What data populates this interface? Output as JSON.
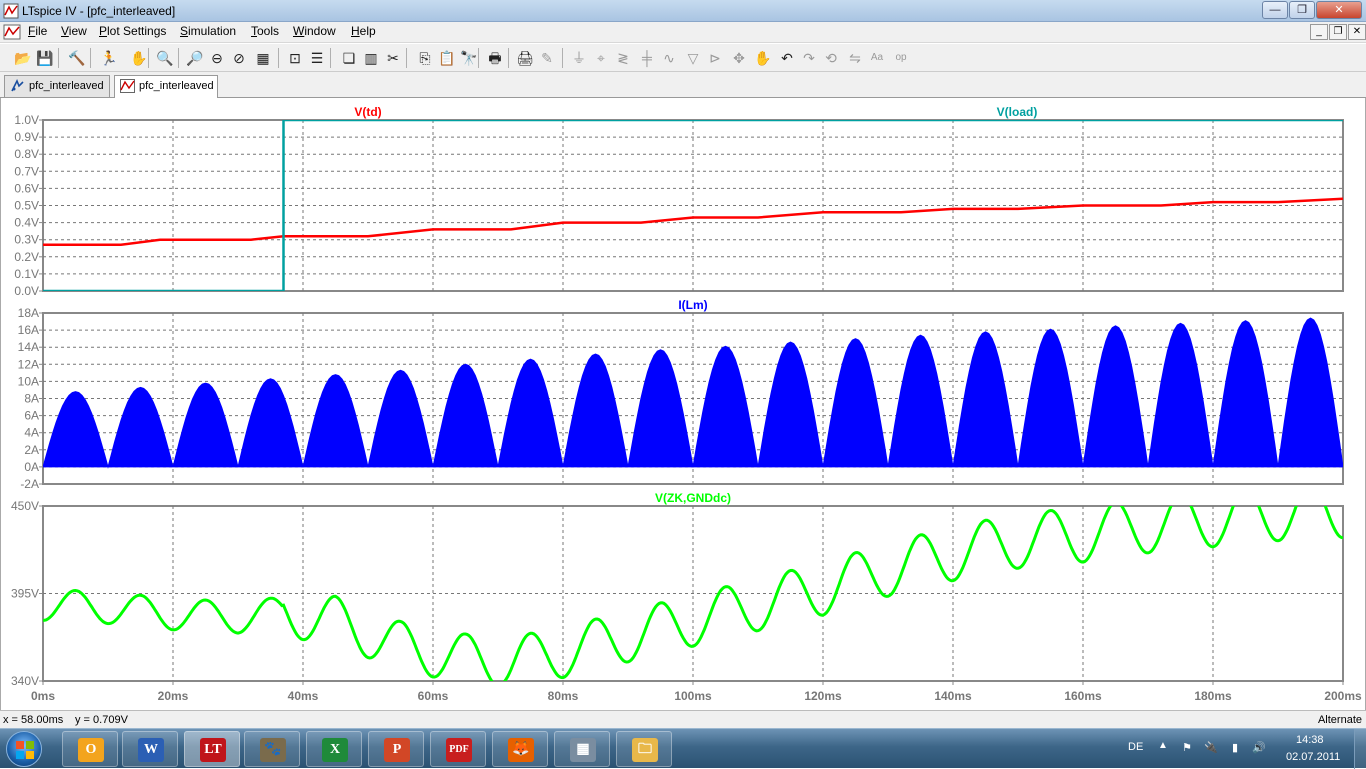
{
  "window": {
    "title": "LTspice IV - [pfc_interleaved]",
    "min_glyph": "—",
    "max_glyph": "❐",
    "close_glyph": "✕"
  },
  "menu": {
    "items": [
      {
        "label": "File",
        "key": "F",
        "rest": "ile"
      },
      {
        "label": "View",
        "key": "V",
        "rest": "iew"
      },
      {
        "label": "Plot Settings",
        "key": "P",
        "rest": "lot Settings"
      },
      {
        "label": "Simulation",
        "key": "S",
        "rest": "imulation"
      },
      {
        "label": "Tools",
        "key": "T",
        "rest": "ools"
      },
      {
        "label": "Window",
        "key": "W",
        "rest": "indow"
      },
      {
        "label": "Help",
        "key": "H",
        "rest": "elp"
      }
    ],
    "mdi_min": "_",
    "mdi_restore": "❐",
    "mdi_close": "✕"
  },
  "toolbar": {
    "buttons": [
      {
        "name": "open-icon",
        "glyph": "📂",
        "enabled": true
      },
      {
        "name": "save-icon",
        "glyph": "💾",
        "enabled": true
      },
      {
        "name": "control-panel-icon",
        "glyph": "🔨",
        "enabled": true
      },
      {
        "name": "run-icon",
        "glyph": "🏃",
        "enabled": true
      },
      {
        "name": "halt-icon",
        "glyph": "✋",
        "enabled": false
      },
      {
        "name": "zoom-in-icon",
        "glyph": "🔍",
        "enabled": true
      },
      {
        "name": "zoom-area-icon",
        "glyph": "🔎",
        "enabled": true
      },
      {
        "name": "zoom-out-icon",
        "glyph": "⊖",
        "enabled": true
      },
      {
        "name": "zoom-cancel-icon",
        "glyph": "⊘",
        "enabled": true
      },
      {
        "name": "autorange-icon",
        "glyph": "▦",
        "enabled": true
      },
      {
        "name": "pick-visible-icon",
        "glyph": "⊡",
        "enabled": true
      },
      {
        "name": "tile-horizontal-icon",
        "glyph": "☰",
        "enabled": true
      },
      {
        "name": "cascade-icon",
        "glyph": "❏",
        "enabled": true
      },
      {
        "name": "tile-vertical-icon",
        "glyph": "▥",
        "enabled": true
      },
      {
        "name": "cut-icon",
        "glyph": "✂",
        "enabled": true
      },
      {
        "name": "copy-icon",
        "glyph": "⎘",
        "enabled": true
      },
      {
        "name": "paste-icon",
        "glyph": "📋",
        "enabled": true
      },
      {
        "name": "find-icon",
        "glyph": "🔭",
        "enabled": true
      },
      {
        "name": "print-setup-icon",
        "glyph": "🖶",
        "enabled": true
      },
      {
        "name": "print-icon",
        "glyph": "🖨",
        "enabled": true
      },
      {
        "name": "wire-icon",
        "glyph": "✎",
        "enabled": false
      },
      {
        "name": "ground-icon",
        "glyph": "⏚",
        "enabled": false
      },
      {
        "name": "label-net-icon",
        "glyph": "⌖",
        "enabled": false
      },
      {
        "name": "resistor-icon",
        "glyph": "≷",
        "enabled": false
      },
      {
        "name": "capacitor-icon",
        "glyph": "╪",
        "enabled": false
      },
      {
        "name": "inductor-icon",
        "glyph": "∿",
        "enabled": false
      },
      {
        "name": "diode-icon",
        "glyph": "▽",
        "enabled": false
      },
      {
        "name": "component-icon",
        "glyph": "⊳",
        "enabled": false
      },
      {
        "name": "move-icon",
        "glyph": "✥",
        "enabled": false
      },
      {
        "name": "drag-icon",
        "glyph": "✋",
        "enabled": false
      },
      {
        "name": "undo-icon",
        "glyph": "↶",
        "enabled": true
      },
      {
        "name": "redo-icon",
        "glyph": "↷",
        "enabled": false
      },
      {
        "name": "rotate-icon",
        "glyph": "⟲",
        "enabled": false
      },
      {
        "name": "mirror-icon",
        "glyph": "⇋",
        "enabled": false
      },
      {
        "name": "text-icon",
        "glyph": "Aa",
        "enabled": false
      },
      {
        "name": "spice-directive-icon",
        "glyph": "op",
        "enabled": false
      }
    ]
  },
  "tabs": [
    {
      "label": "pfc_interleaved",
      "active": false
    },
    {
      "label": "pfc_interleaved",
      "active": true
    }
  ],
  "chart_data": [
    {
      "type": "line",
      "x_unit": "ms",
      "xlim": [
        0,
        200
      ],
      "ylim": [
        0,
        1
      ],
      "grid": true,
      "x_ticks": [
        "0ms",
        "20ms",
        "40ms",
        "60ms",
        "80ms",
        "100ms",
        "120ms",
        "140ms",
        "160ms",
        "180ms",
        "200ms"
      ],
      "y_ticks": [
        "0.0V",
        "0.1V",
        "0.2V",
        "0.3V",
        "0.4V",
        "0.5V",
        "0.6V",
        "0.7V",
        "0.8V",
        "0.9V",
        "1.0V"
      ],
      "series": [
        {
          "name": "V(td)",
          "color": "#ff0000",
          "x": [
            0,
            12,
            18,
            28,
            32,
            37,
            50,
            60,
            72,
            80,
            92,
            100,
            110,
            120,
            132,
            140,
            150,
            160,
            172,
            180,
            190,
            200
          ],
          "y": [
            0.27,
            0.27,
            0.3,
            0.3,
            0.3,
            0.32,
            0.32,
            0.36,
            0.36,
            0.4,
            0.4,
            0.43,
            0.43,
            0.46,
            0.46,
            0.48,
            0.48,
            0.5,
            0.5,
            0.52,
            0.52,
            0.54
          ]
        },
        {
          "name": "V(load)",
          "color": "#00a0a0",
          "x": [
            0,
            37,
            37,
            200
          ],
          "y": [
            0,
            0,
            1,
            1
          ]
        }
      ]
    },
    {
      "type": "area",
      "x_unit": "ms",
      "xlim": [
        0,
        200
      ],
      "ylim": [
        -2,
        18
      ],
      "grid": true,
      "y_ticks": [
        "-2A",
        "0A",
        "2A",
        "4A",
        "6A",
        "8A",
        "10A",
        "12A",
        "14A",
        "16A",
        "18A"
      ],
      "series": [
        {
          "name": "I(Lm)",
          "color": "#0000ff",
          "period_ms": 10,
          "peaks": [
            8.8,
            9.3,
            9.8,
            10.3,
            10.8,
            11.3,
            12.0,
            12.6,
            13.2,
            13.7,
            14.1,
            14.6,
            15.0,
            15.4,
            15.8,
            16.1,
            16.5,
            16.8,
            17.1,
            17.4
          ]
        }
      ]
    },
    {
      "type": "line",
      "x_unit": "ms",
      "xlim": [
        0,
        200
      ],
      "ylim": [
        340,
        450
      ],
      "grid": true,
      "y_ticks": [
        "340V",
        "395V",
        "450V"
      ],
      "series": [
        {
          "name": "V(ZK,GNDdc)",
          "color": "#00ff00",
          "x": [
            0,
            10,
            20,
            30,
            37,
            45,
            55,
            65,
            72,
            80,
            90,
            100,
            110,
            120,
            130,
            140,
            150,
            160,
            170,
            180,
            190,
            200
          ],
          "y": [
            388,
            386,
            382,
            380,
            383,
            378,
            362,
            354,
            352,
            358,
            368,
            378,
            388,
            398,
            410,
            420,
            428,
            432,
            438,
            442,
            446,
            448
          ],
          "ripple_amp_v": 18,
          "ripple_period_ms": 10
        }
      ]
    }
  ],
  "status": {
    "x_readout": "x = 58.00ms",
    "y_readout": "y = 0.709V",
    "mode": "Alternate"
  },
  "taskbar": {
    "apps": [
      {
        "name": "outlook-taskbar-icon",
        "glyph": "O",
        "color": "#f3a41d"
      },
      {
        "name": "word-taskbar-icon",
        "glyph": "W",
        "color": "#2b5fb4"
      },
      {
        "name": "ltspice-taskbar-icon",
        "glyph": "LT",
        "color": "#c0141a"
      },
      {
        "name": "gimp-taskbar-icon",
        "glyph": "🐾",
        "color": "#7a6b4c"
      },
      {
        "name": "excel-taskbar-icon",
        "glyph": "X",
        "color": "#1f8a3a"
      },
      {
        "name": "powerpoint-taskbar-icon",
        "glyph": "P",
        "color": "#d24726"
      },
      {
        "name": "pdf-printer-taskbar-icon",
        "glyph": "PDF",
        "color": "#c81e1e"
      },
      {
        "name": "firefox-taskbar-icon",
        "glyph": "🦊",
        "color": "#e66000"
      },
      {
        "name": "calculator-taskbar-icon",
        "glyph": "▦",
        "color": "#7a8da0"
      },
      {
        "name": "explorer-taskbar-icon",
        "glyph": "🗀",
        "color": "#e8b84a"
      }
    ],
    "tray": {
      "lang": "DE",
      "time": "14:38",
      "date": "02.07.2011"
    }
  }
}
